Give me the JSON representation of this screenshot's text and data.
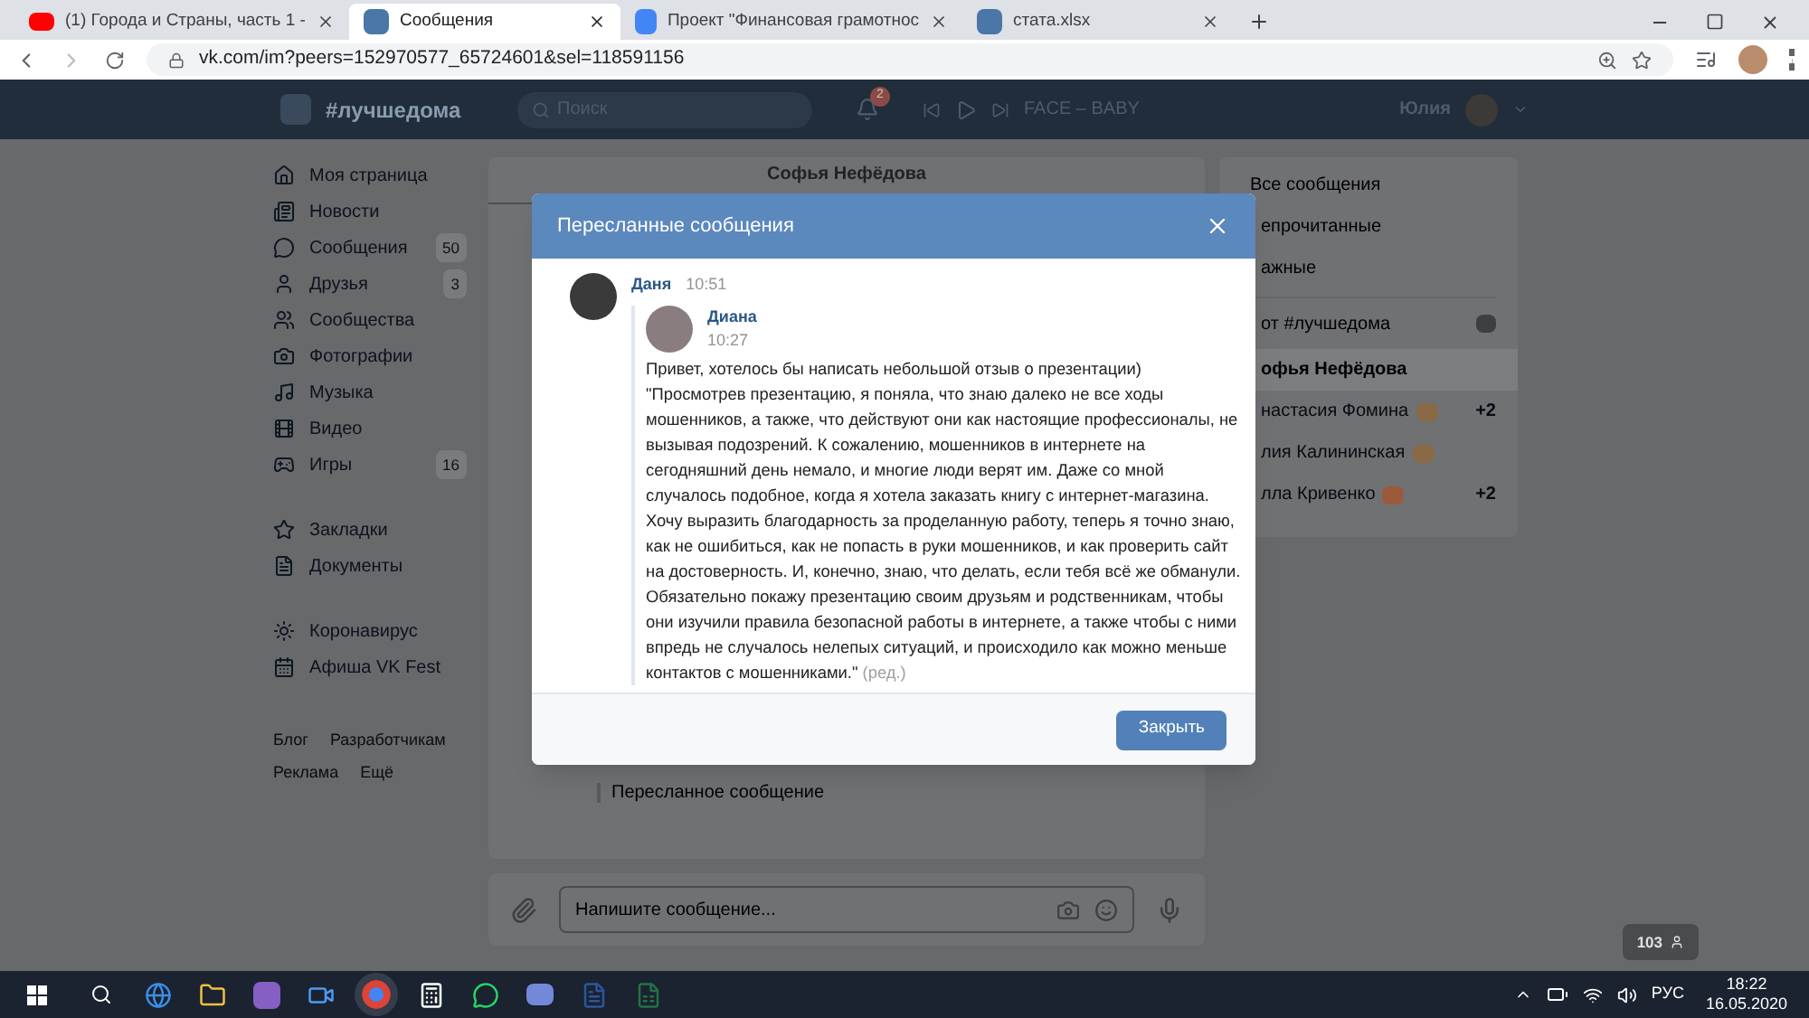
{
  "browser": {
    "tabs": [
      {
        "title": "(1) Города и Страны, часть 1 -",
        "selected": false,
        "kind": "video"
      },
      {
        "title": "Сообщения",
        "selected": true,
        "kind": "vk"
      },
      {
        "title": "Проект \"Финансовая грамотнос",
        "selected": false,
        "kind": "doc"
      },
      {
        "title": "стата.xlsx",
        "selected": false,
        "kind": "vk"
      }
    ],
    "url": "vk.com/im?peers=152970577_65724601&sel=118591156"
  },
  "header": {
    "title": "#лучшедома",
    "search_placeholder": "Поиск",
    "notifications": "2",
    "track": "FACE – BABY",
    "user": "Юлия"
  },
  "sidebar": {
    "groups": [
      [
        {
          "label": "Моя страница"
        },
        {
          "label": "Новости"
        },
        {
          "label": "Сообщения",
          "count": "50"
        },
        {
          "label": "Друзья",
          "count": "3"
        },
        {
          "label": "Сообщества"
        },
        {
          "label": "Фотографии"
        },
        {
          "label": "Музыка"
        },
        {
          "label": "Видео"
        },
        {
          "label": "Игры",
          "count": "16"
        }
      ],
      [
        {
          "label": "Закладки"
        },
        {
          "label": "Документы"
        }
      ],
      [
        {
          "label": "Коронавирус"
        },
        {
          "label": "Афиша VK Fest"
        }
      ]
    ],
    "footer": [
      "Блог",
      "Разработчикам",
      "Реклама",
      "Ещё"
    ]
  },
  "chat": {
    "name": "Софья Нефёдова",
    "forwarded_label": "Пересланное сообщение",
    "input_placeholder": "Напишите сообщение..."
  },
  "right_panel": {
    "filters": [
      {
        "label": "Все сообщения"
      },
      {
        "label": "епрочитанные"
      },
      {
        "label": "ажные"
      }
    ],
    "community": "от #лучшедома",
    "chats": [
      {
        "name": "офья Нефёдова",
        "selected": true
      },
      {
        "name": "настасия Фомина",
        "kind": "cat",
        "count": "+2",
        "selected": false
      },
      {
        "name": "лия Калининская",
        "kind": "cat",
        "selected": false
      },
      {
        "name": "лла Кривенко",
        "kind": "cake",
        "count": "+2",
        "selected": false
      }
    ]
  },
  "modal": {
    "title": "Пересланные сообщения",
    "sender": "Даня",
    "time": "10:51",
    "forwarded": {
      "author": "Диана",
      "time": "10:27",
      "text": "Привет, хотелось бы написать небольшой отзыв о презентации)\n\"Просмотрев презентацию, я поняла, что знаю далеко не все ходы мошенников, а также, что действуют они как настоящие профессионалы, не вызывая подозрений. К сожалению, мошенников в интернете на сегодняшний день немало, и многие люди верят им. Даже со мной случалось подобное, когда я хотела заказать книгу с интернет-магазина. Хочу выразить благодарность за проделанную работу, теперь я точно знаю, как не ошибиться, как не попасть в руки мошенников, и как проверить сайт на достоверность. И, конечно, знаю, что делать, если тебя всё же обманули. Обязательно покажу презентацию своим друзьям и родственникам, чтобы они изучили правила безопасной работы в интернете, а также чтобы с ними впредь не случалось нелепых ситуаций, и происходило как можно меньше контактов с мошенниками.\"",
      "edited": "(ред.)"
    },
    "close_button": "Закрыть"
  },
  "online_badge": "103",
  "taskbar": {
    "language": "РУС",
    "time": "18:22",
    "date": "16.05.2020"
  }
}
